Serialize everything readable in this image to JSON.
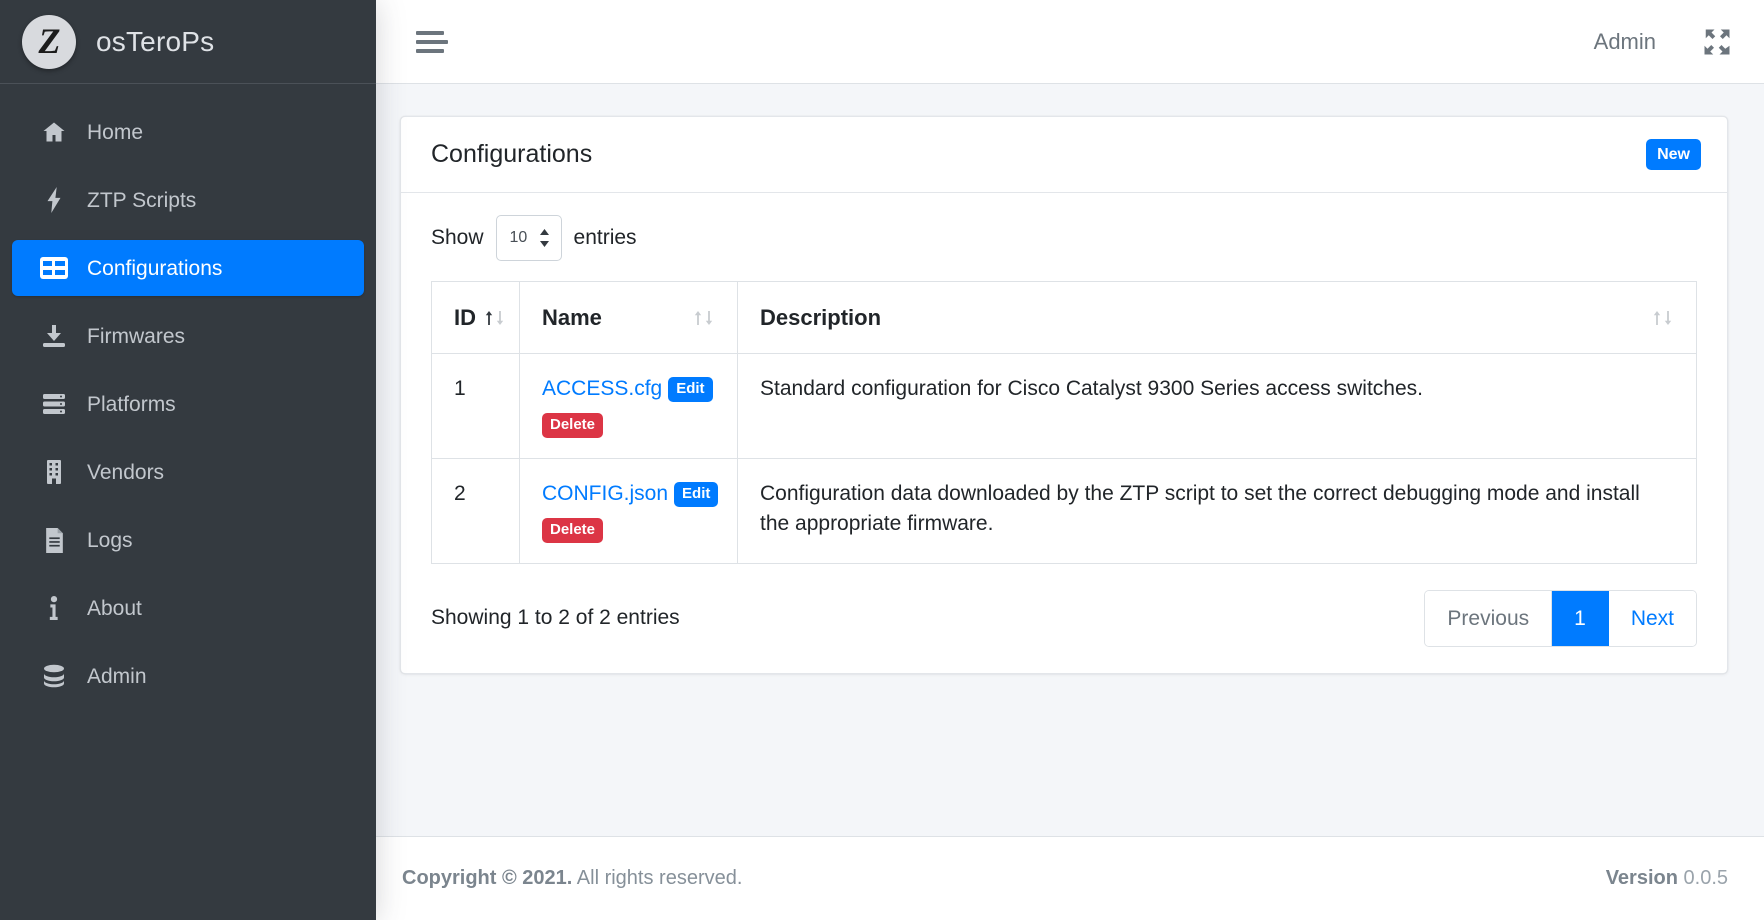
{
  "brand": {
    "logo_letter": "Z",
    "logo_icon": "brand-logo-z",
    "title": "osTeroPs"
  },
  "sidebar": {
    "items": [
      {
        "label": "Home",
        "icon": "home-icon",
        "active": false
      },
      {
        "label": "ZTP Scripts",
        "icon": "bolt-icon",
        "active": false
      },
      {
        "label": "Configurations",
        "icon": "table-grid-icon",
        "active": true
      },
      {
        "label": "Firmwares",
        "icon": "download-icon",
        "active": false
      },
      {
        "label": "Platforms",
        "icon": "server-stack-icon",
        "active": false
      },
      {
        "label": "Vendors",
        "icon": "building-icon",
        "active": false
      },
      {
        "label": "Logs",
        "icon": "file-lines-icon",
        "active": false
      },
      {
        "label": "About",
        "icon": "info-icon",
        "active": false
      },
      {
        "label": "Admin",
        "icon": "database-icon",
        "active": false
      }
    ]
  },
  "topbar": {
    "menu_icon": "hamburger-icon",
    "user_label": "Admin",
    "fullscreen_icon": "expand-arrows-icon"
  },
  "card": {
    "title": "Configurations",
    "new_button_label": "New"
  },
  "datatable": {
    "length_label_prefix": "Show",
    "length_value": "10",
    "length_label_suffix": "entries",
    "columns": [
      {
        "label": "ID",
        "sort": "asc",
        "name": "col-id"
      },
      {
        "label": "Name",
        "sort": "none",
        "name": "col-name"
      },
      {
        "label": "Description",
        "sort": "none",
        "name": "col-desc"
      }
    ],
    "rows": [
      {
        "id": "1",
        "name": "ACCESS.cfg",
        "edit_label": "Edit",
        "delete_label": "Delete",
        "description": "Standard configuration for Cisco Catalyst 9300 Series access switches."
      },
      {
        "id": "2",
        "name": "CONFIG.json",
        "edit_label": "Edit",
        "delete_label": "Delete",
        "description": "Configuration data downloaded by the ZTP script to set the correct debugging mode and install the appropriate firmware."
      }
    ],
    "info": "Showing 1 to 2 of 2 entries",
    "pagination": {
      "previous_label": "Previous",
      "pages": [
        "1"
      ],
      "current_page": "1",
      "next_label": "Next"
    }
  },
  "footer": {
    "copyright_strong": "Copyright © 2021.",
    "copyright_rest": " All rights reserved.",
    "version_label": "Version",
    "version_value": "0.0.5"
  },
  "colors": {
    "sidebar_bg": "#343a40",
    "accent": "#007bff",
    "danger": "#dc3545",
    "page_bg": "#f4f6f9"
  }
}
